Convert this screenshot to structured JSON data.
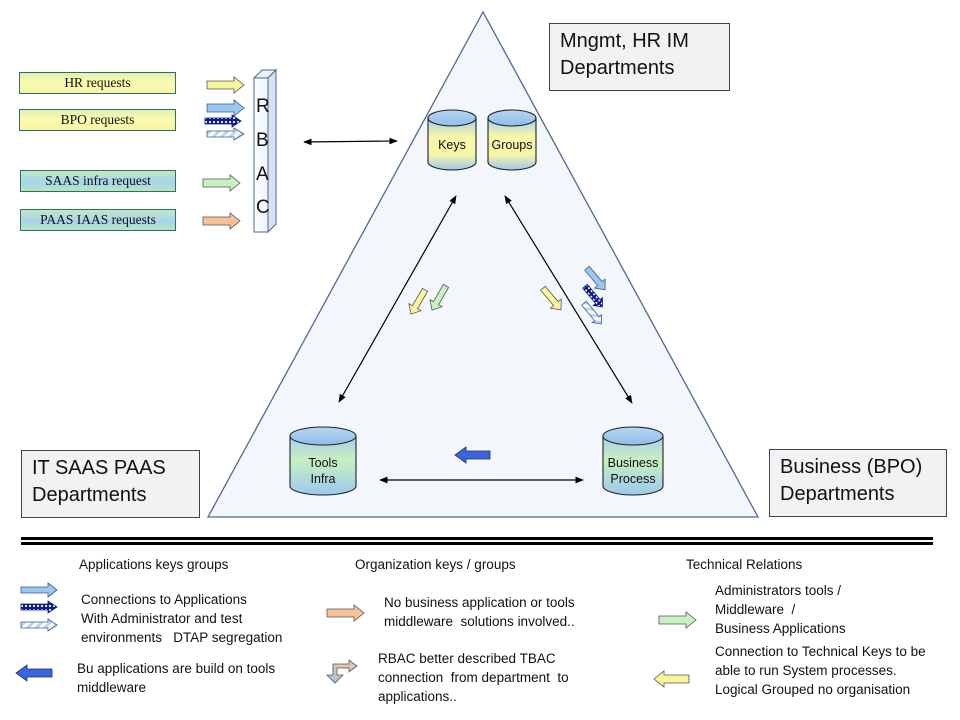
{
  "rbac": {
    "letters": [
      "R",
      "B",
      "A",
      "C"
    ]
  },
  "requests": [
    {
      "label": "HR requests",
      "style": "yellow"
    },
    {
      "label": "BPO requests",
      "style": "yellow"
    },
    {
      "label": "SAAS infra request",
      "style": "blue"
    },
    {
      "label": "PAAS IAAS requests",
      "style": "blue"
    }
  ],
  "departments": {
    "top": {
      "line1": "Mngmt, HR IM",
      "line2": "Departments"
    },
    "left": {
      "line1": "IT SAAS PAAS",
      "line2": "Departments"
    },
    "right": {
      "line1": "Business (BPO)",
      "line2": "Departments"
    }
  },
  "cylinders": {
    "keys": {
      "line1": "Keys"
    },
    "groups": {
      "line1": "Groups"
    },
    "tools": {
      "line1": "Tools",
      "line2": "Infra"
    },
    "business": {
      "line1": "Business",
      "line2": "Process"
    }
  },
  "legend": {
    "col1": {
      "heading": "Applications keys groups",
      "item1": [
        "Connections to Applications",
        "With Administrator and test",
        "environments   DTAP segregation"
      ],
      "item2": [
        "Bu applications are build on tools",
        "middleware"
      ]
    },
    "col2": {
      "heading": "Organization keys / groups",
      "item1": [
        "No business application or tools",
        "middleware  solutions involved.."
      ],
      "item2": [
        "RBAC better described TBAC",
        "connection  from department  to",
        "applications.."
      ]
    },
    "col3": {
      "heading": "Technical Relations",
      "item1": [
        "Administrators tools /",
        "Middleware  /",
        "Business Applications"
      ],
      "item2": [
        "Connection to Technical Keys to be",
        "able to run System processes.",
        "Logical Grouped no organisation"
      ]
    }
  },
  "colors": {
    "triangle_fill": "#f3f7fc",
    "triangle_stroke": "#4a6a96",
    "arrow_yellow": "#faf59a",
    "arrow_blue_light": "#9cc7ef",
    "arrow_green": "#c9f0c0",
    "arrow_orange": "#f7c29a",
    "arrow_blue_dark": "#3a66dc",
    "arrow_navy": "#0a1a8c"
  }
}
